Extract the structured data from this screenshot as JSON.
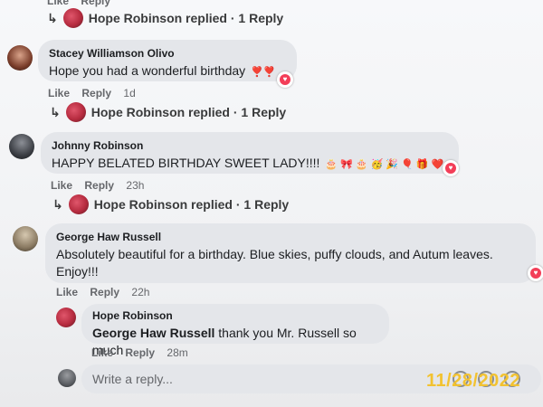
{
  "top_partial": {
    "like": "Like",
    "reply": "Reply",
    "replied": "Hope Robinson replied · 1 Reply"
  },
  "comments": [
    {
      "author": "Stacey Williamson Olivo",
      "text": "Hope you had a wonderful birthday",
      "emojis": "❣️❣️",
      "like": "Like",
      "reply": "Reply",
      "time": "1d",
      "replied": "Hope Robinson replied · 1 Reply"
    },
    {
      "author": "Johnny Robinson",
      "text": "HAPPY BELATED BIRTHDAY SWEET LADY!!!!",
      "emojis": "🎂 🎀 🎂 🥳 🎉 🎈 🎁 ❤️",
      "like": "Like",
      "reply": "Reply",
      "time": "23h",
      "replied": "Hope Robinson replied · 1 Reply"
    },
    {
      "author": "George Haw Russell",
      "text_line1": "Absolutely beautiful for a birthday. Blue skies, puffy clouds, and Autum leaves.",
      "text_line2": "Enjoy!!!",
      "like": "Like",
      "reply": "Reply",
      "time": "22h"
    }
  ],
  "nested_reply": {
    "author": "Hope Robinson",
    "mention": "George Haw Russell",
    "text": " thank you Mr. Russell so much",
    "like": "Like",
    "reply": "Reply",
    "time": "28m"
  },
  "composer": {
    "placeholder": "Write a reply..."
  },
  "date_stamp": "11/28/2022",
  "colors": {
    "bubble": "#e4e6ea",
    "heart": "#f33e58",
    "stamp": "#f2c230"
  }
}
